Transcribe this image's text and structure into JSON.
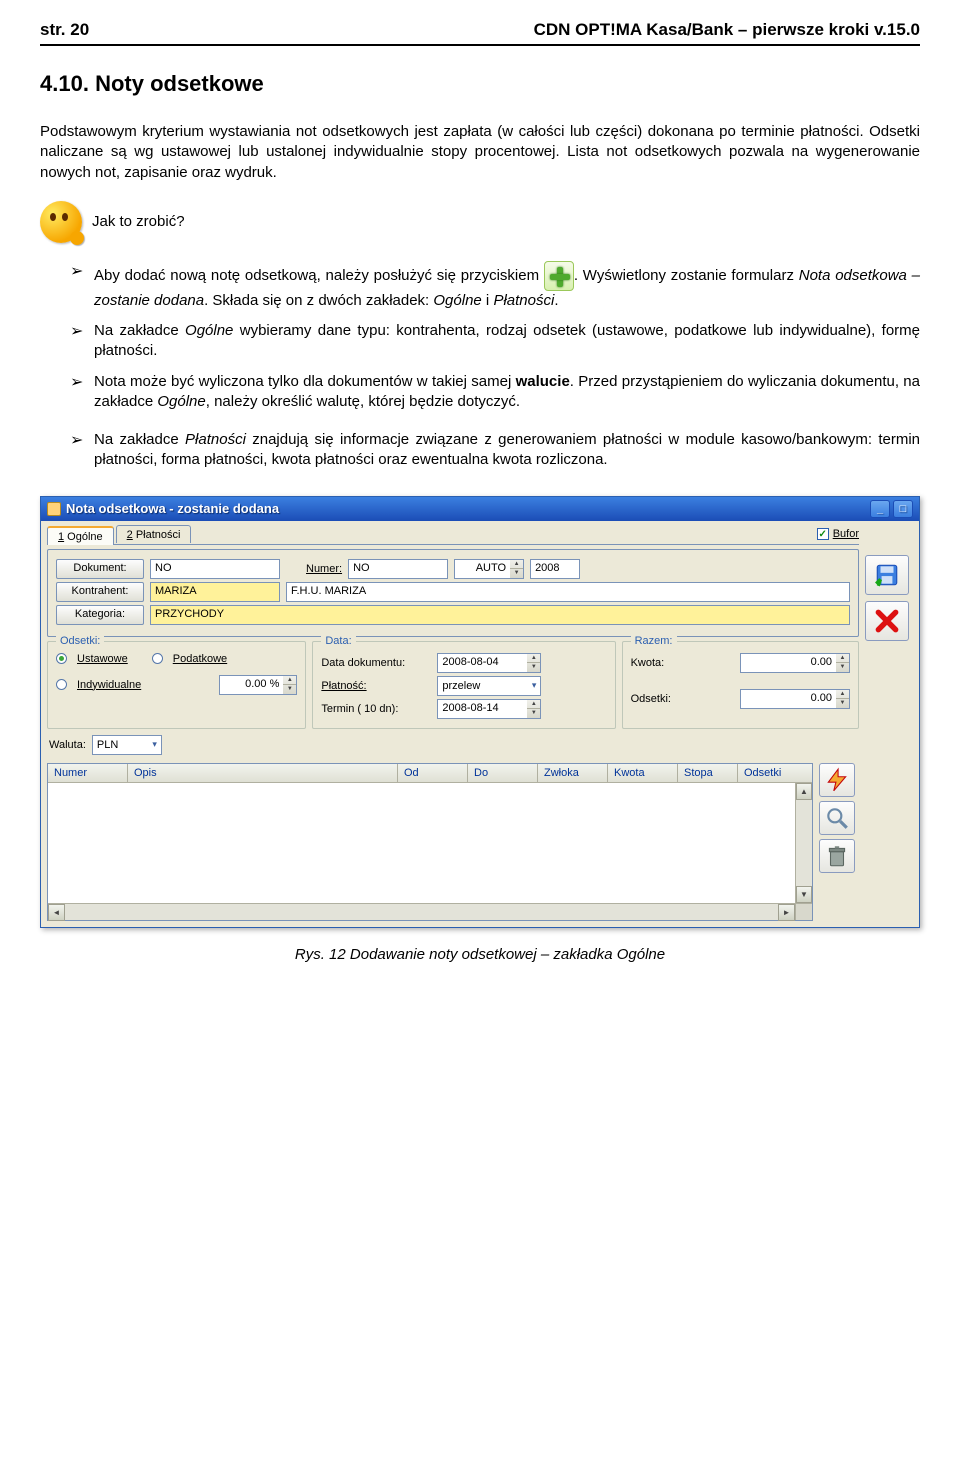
{
  "header": {
    "left": "str. 20",
    "right": "CDN OPT!MA Kasa/Bank – pierwsze kroki v.15.0"
  },
  "section": {
    "number": "4.10.",
    "title": "Noty odsetkowe"
  },
  "p1": "Podstawowym kryterium wystawiania not odsetkowych jest zapłata (w całości lub części) dokonana po terminie płatności. Odsetki naliczane są wg ustawowej lub ustalonej indywidualnie stopy procentowej. Lista not odsetkowych pozwala na wygenerowanie nowych not, zapisanie oraz wydruk.",
  "howto": "Jak to zrobić?",
  "bullets": {
    "b1a": "Aby dodać nową notę odsetkową, należy posłużyć się przyciskiem ",
    "b1b": ". Wyświetlony zostanie formularz ",
    "b1b_em": "Nota odsetkowa – zostanie dodana",
    "b1c": ". Składa się on z dwóch zakładek: ",
    "b1c_em1": "Ogólne",
    "b1c_mid": " i ",
    "b1c_em2": "Płatności",
    "b1c_end": ".",
    "b2a": "Na zakładce ",
    "b2a_em": "Ogólne",
    "b2b": " wybieramy dane typu: kontrahenta, rodzaj odsetek (ustawowe, podatkowe lub indywidualne), formę płatności.",
    "b3a": "Nota może być wyliczona tylko dla dokumentów w takiej samej ",
    "b3_bold": "walucie",
    "b3b": ". Przed przystąpieniem do wyliczania dokumentu, na zakładce ",
    "b3_em": "Ogólne",
    "b3c": ", należy określić walutę, której będzie dotyczyć.",
    "b4a": "Na zakładce ",
    "b4_em": "Płatności",
    "b4b": " znajdują się informacje związane z generowaniem płatności w module kasowo/bankowym: termin płatności, forma płatności, kwota płatności oraz ewentualna kwota rozliczona."
  },
  "window": {
    "title": "Nota odsetkowa - zostanie dodana",
    "tab1_u": "1",
    "tab1": " Ogólne",
    "tab2_u": "2",
    "tab2": " Płatności",
    "bufor": "Bufor",
    "labels": {
      "dokument": "Dokument:",
      "numer": "Numer:",
      "kontrahent": "Kontrahent:",
      "kategoria": "Kategoria:",
      "odsetki_g": "Odsetki:",
      "ustawowe": "Ustawowe",
      "podatkowe": "Podatkowe",
      "indywidualne": "Indywidualne",
      "data_g": "Data:",
      "data_dok": "Data dokumentu:",
      "platnosc": "Płatność:",
      "termin": "Termin (  10 dn):",
      "razem_g": "Razem:",
      "kwota": "Kwota:",
      "odsetki": "Odsetki:",
      "waluta": "Waluta:"
    },
    "values": {
      "dokument": "NO",
      "numer_seg1": "NO",
      "numer_seg2": "AUTO",
      "numer_seg3": "2008",
      "kontrahent_code": "MARIZA",
      "kontrahent_name": "F.H.U. MARIZA",
      "kategoria": "PRZYCHODY",
      "indyw_val": "0.00 %",
      "data_dok": "2008-08-04",
      "platnosc": "przelew",
      "termin": "2008-08-14",
      "kwota": "0.00",
      "odsetki": "0.00",
      "waluta": "PLN"
    },
    "columns": {
      "numer": "Numer",
      "opis": "Opis",
      "od": "Od",
      "do": "Do",
      "zwloka": "Zwłoka",
      "kwota": "Kwota",
      "stopa": "Stopa",
      "odsetki": "Odsetki"
    }
  },
  "caption": "Rys. 12 Dodawanie noty odsetkowej – zakładka Ogólne"
}
